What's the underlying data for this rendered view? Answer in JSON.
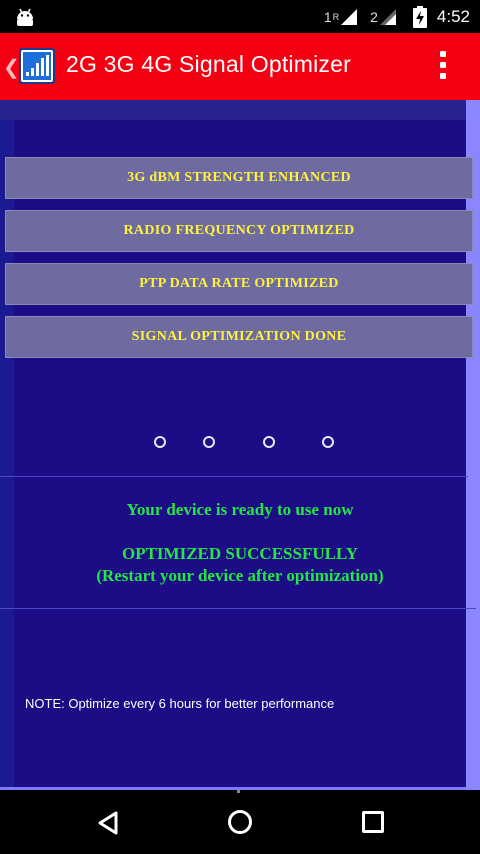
{
  "status_bar": {
    "sim1_label": "1",
    "sim1_roaming": "R",
    "sim2_label": "2",
    "time": "4:52",
    "icons": [
      "android-icon",
      "signal-icon",
      "battery-charging-icon"
    ]
  },
  "action_bar": {
    "title": "2G 3G 4G Signal Optimizer",
    "back_glyph": "❮",
    "icons": [
      "app-signal-icon",
      "overflow-menu-icon"
    ]
  },
  "buttons": [
    {
      "label": "3G dBM STRENGTH ENHANCED"
    },
    {
      "label": "RADIO FREQUENCY OPTIMIZED"
    },
    {
      "label": "PTP DATA RATE OPTIMIZED"
    },
    {
      "label": "SIGNAL OPTIMIZATION DONE"
    }
  ],
  "progress_dots": 4,
  "messages": {
    "ready": "Your device is ready to use now",
    "success_line1": "OPTIMIZED SUCCESSFULLY",
    "success_line2": "(Restart your device after optimization)",
    "note": "NOTE: Optimize every 6 hours for better performance"
  },
  "colors": {
    "action_bar": "#f50012",
    "panel": "#1c0c86",
    "button_text": "#fff23d",
    "message_text": "#25e644"
  },
  "nav_bar": {
    "icons": [
      "back-triangle-icon",
      "home-circle-icon",
      "recent-apps-square-icon"
    ]
  }
}
